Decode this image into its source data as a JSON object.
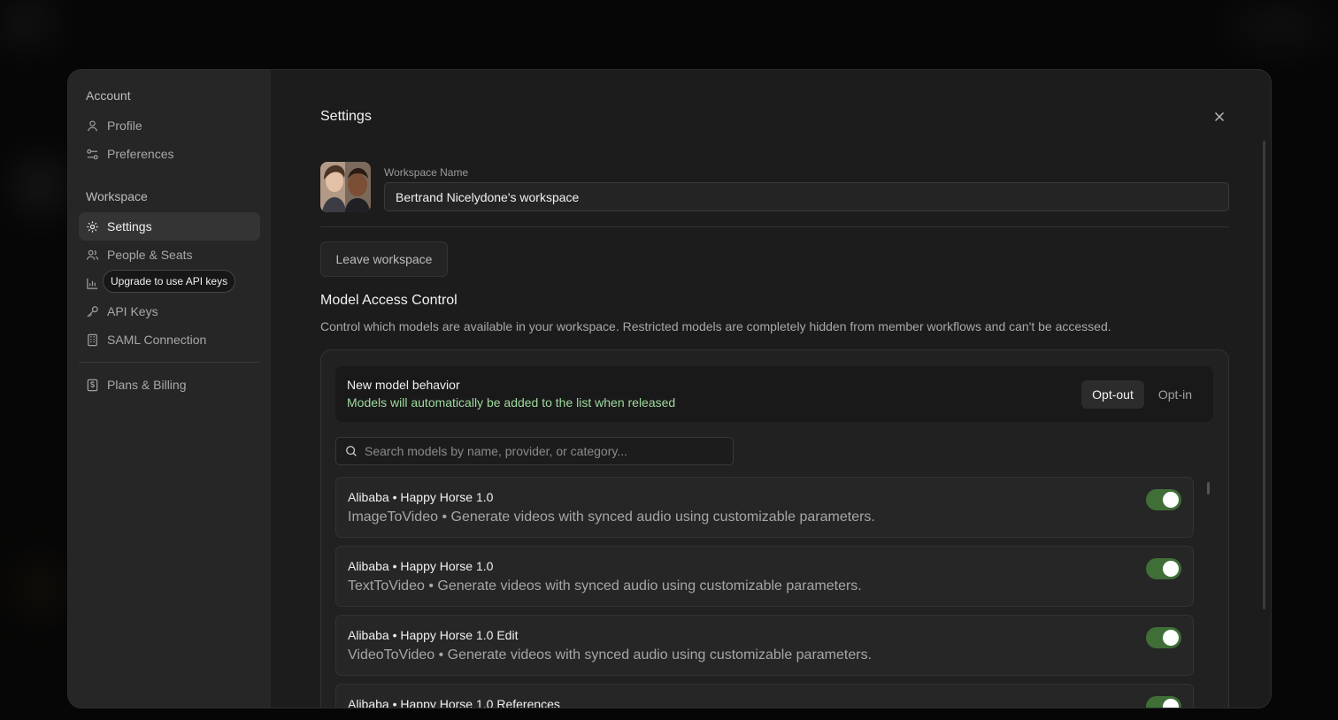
{
  "sidebar": {
    "account_section": "Account",
    "workspace_section": "Workspace",
    "items": [
      {
        "label": "Profile"
      },
      {
        "label": "Preferences"
      },
      {
        "label": "Settings"
      },
      {
        "label": "People & Seats"
      },
      {
        "label": "Usage"
      },
      {
        "label": "API Keys"
      },
      {
        "label": "SAML Connection"
      },
      {
        "label": "Plans & Billing"
      }
    ],
    "tooltip": "Upgrade to use API keys"
  },
  "main": {
    "title": "Settings",
    "workspace_name_label": "Workspace Name",
    "workspace_name_value": "Bertrand Nicelydone's workspace",
    "leave_button": "Leave workspace",
    "model_access": {
      "title": "Model Access Control",
      "description": "Control which models are available in your workspace. Restricted models are completely hidden from member workflows and can't be accessed.",
      "behavior_title": "New model behavior",
      "behavior_subtitle": "Models will automatically be added to the list when released",
      "opt_out": "Opt-out",
      "opt_in": "Opt-in",
      "selected": "Opt-out",
      "search_placeholder": "Search models by name, provider, or category...",
      "models": [
        {
          "title": "Alibaba • Happy Horse 1.0",
          "desc": "ImageToVideo • Generate videos with synced audio using customizable parameters.",
          "enabled": true
        },
        {
          "title": "Alibaba • Happy Horse 1.0",
          "desc": "TextToVideo • Generate videos with synced audio using customizable parameters.",
          "enabled": true
        },
        {
          "title": "Alibaba • Happy Horse 1.0 Edit",
          "desc": "VideoToVideo • Generate videos with synced audio using customizable parameters.",
          "enabled": true
        },
        {
          "title": "Alibaba • Happy Horse 1.0 References",
          "desc": "",
          "enabled": true
        }
      ]
    }
  },
  "colors": {
    "accent_green": "#9fd99f",
    "toggle_on": "#3f6e37"
  }
}
